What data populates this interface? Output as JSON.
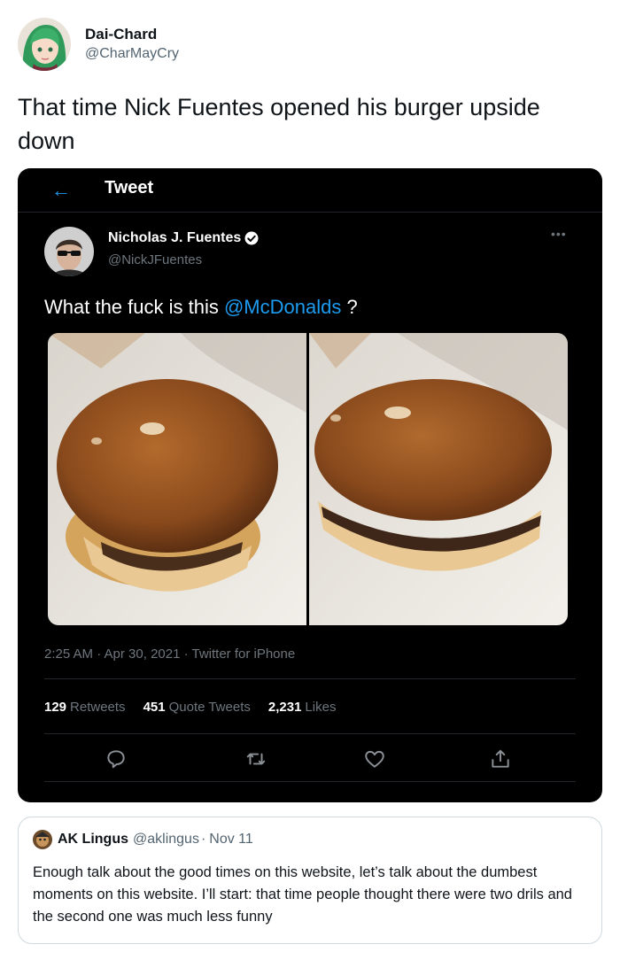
{
  "outer_tweet": {
    "name": "Dai-Chard",
    "handle": "@CharMayCry",
    "text": "That time Nick Fuentes opened his burger upside down"
  },
  "embedded_tweet": {
    "header_title": "Tweet",
    "author_name": "Nicholas J. Fuentes",
    "author_handle": "@NickJFuentes",
    "text_prefix": "What the fuck is this ",
    "mention": "@McDonalds",
    "text_suffix": " ?",
    "meta": "2:25 AM · Apr 30, 2021 · Twitter for iPhone",
    "retweets_count": "129",
    "retweets_label": "Retweets",
    "quotes_count": "451",
    "quotes_label": "Quote Tweets",
    "likes_count": "2,231",
    "likes_label": "Likes",
    "accent_color": "#1d9bf0"
  },
  "quoted_tweet": {
    "name": "AK Lingus",
    "handle": "@aklingus",
    "date": "Nov 11",
    "text": "Enough talk about the good times on this website, let’s talk about the dumbest moments on this website. I’ll start: that time people thought there were two drils and the second one was much less funny"
  },
  "icons": [
    "back-arrow-icon",
    "verified-icon",
    "more-icon",
    "reply-icon",
    "retweet-icon",
    "like-icon",
    "share-icon"
  ]
}
